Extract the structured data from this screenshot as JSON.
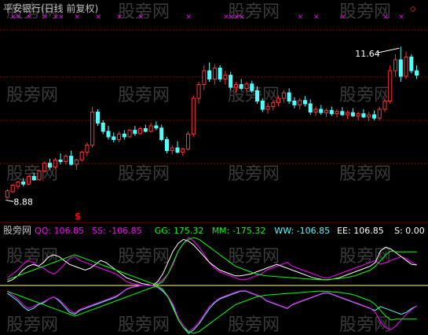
{
  "window": {
    "title": "平安银行(日线 前复权)"
  },
  "watermark": {
    "text": "股旁网"
  },
  "colors": {
    "background": "#000000",
    "up_candle": "#ff3232",
    "down_candle": "#54fcfc",
    "grid": "#8b0000",
    "magenta": "#ff00ff",
    "white": "#ffffff",
    "green": "#00ff00",
    "yellow": "#ffff00",
    "cyan": "#54fcfc",
    "title": "#c0c0c0",
    "signal": "#ff0000"
  },
  "price_panel": {
    "high_label": "11.64",
    "low_label": "8.88",
    "signal_label": "$",
    "ylim": [
      8.6,
      12.2
    ],
    "marker_count": 20
  },
  "indicator_panel": {
    "name": "股旁网",
    "readouts": [
      {
        "label": "QQ: 106.85",
        "color": "#ff00ff"
      },
      {
        "label": "SS: -106.85",
        "color": "#ff00ff"
      },
      {
        "label": "GG: 175.32",
        "color": "#00ff00"
      },
      {
        "label": "MM: -175.32",
        "color": "#00ff00"
      },
      {
        "label": "WW: -106.85",
        "color": "#54fcfc"
      },
      {
        "label": "EE: 106.85",
        "color": "#ffffff"
      },
      {
        "label": "S: 0.00",
        "color": "#ffffff"
      }
    ]
  },
  "chart_data": {
    "type": "candlestick",
    "title": "平安银行(日线 前复权)",
    "annotations": [
      "11.64",
      "8.88"
    ],
    "candles": [
      {
        "o": 8.9,
        "h": 9.05,
        "l": 8.88,
        "c": 9.02
      },
      {
        "o": 9.0,
        "h": 9.15,
        "l": 8.98,
        "c": 9.12
      },
      {
        "o": 9.1,
        "h": 9.2,
        "l": 9.05,
        "c": 9.18
      },
      {
        "o": 9.18,
        "h": 9.25,
        "l": 9.1,
        "c": 9.14
      },
      {
        "o": 9.14,
        "h": 9.3,
        "l": 9.12,
        "c": 9.28
      },
      {
        "o": 9.28,
        "h": 9.35,
        "l": 9.2,
        "c": 9.22
      },
      {
        "o": 9.22,
        "h": 9.4,
        "l": 9.2,
        "c": 9.38
      },
      {
        "o": 9.38,
        "h": 9.55,
        "l": 9.35,
        "c": 9.52
      },
      {
        "o": 9.52,
        "h": 9.6,
        "l": 9.4,
        "c": 9.45
      },
      {
        "o": 9.45,
        "h": 9.62,
        "l": 9.42,
        "c": 9.58
      },
      {
        "o": 9.58,
        "h": 9.7,
        "l": 9.5,
        "c": 9.55
      },
      {
        "o": 9.55,
        "h": 9.68,
        "l": 9.5,
        "c": 9.65
      },
      {
        "o": 9.65,
        "h": 9.75,
        "l": 9.48,
        "c": 9.5
      },
      {
        "o": 9.5,
        "h": 9.6,
        "l": 9.4,
        "c": 9.58
      },
      {
        "o": 9.58,
        "h": 9.75,
        "l": 9.55,
        "c": 9.72
      },
      {
        "o": 9.72,
        "h": 9.9,
        "l": 9.65,
        "c": 9.85
      },
      {
        "o": 9.85,
        "h": 10.55,
        "l": 9.8,
        "c": 10.45
      },
      {
        "o": 10.45,
        "h": 10.5,
        "l": 10.2,
        "c": 10.25
      },
      {
        "o": 10.25,
        "h": 10.3,
        "l": 10.05,
        "c": 10.1
      },
      {
        "o": 10.1,
        "h": 10.2,
        "l": 9.95,
        "c": 10.0
      },
      {
        "o": 10.0,
        "h": 10.08,
        "l": 9.9,
        "c": 9.95
      },
      {
        "o": 9.95,
        "h": 10.1,
        "l": 9.9,
        "c": 10.05
      },
      {
        "o": 10.05,
        "h": 10.12,
        "l": 9.95,
        "c": 10.0
      },
      {
        "o": 10.0,
        "h": 10.15,
        "l": 9.98,
        "c": 10.12
      },
      {
        "o": 10.12,
        "h": 10.2,
        "l": 10.02,
        "c": 10.06
      },
      {
        "o": 10.06,
        "h": 10.18,
        "l": 10.04,
        "c": 10.15
      },
      {
        "o": 10.15,
        "h": 10.22,
        "l": 10.08,
        "c": 10.1
      },
      {
        "o": 10.1,
        "h": 10.25,
        "l": 10.08,
        "c": 10.2
      },
      {
        "o": 10.2,
        "h": 10.28,
        "l": 10.12,
        "c": 10.16
      },
      {
        "o": 10.16,
        "h": 10.22,
        "l": 9.92,
        "c": 9.95
      },
      {
        "o": 9.95,
        "h": 10.0,
        "l": 9.7,
        "c": 9.75
      },
      {
        "o": 9.75,
        "h": 9.85,
        "l": 9.68,
        "c": 9.8
      },
      {
        "o": 9.8,
        "h": 9.92,
        "l": 9.7,
        "c": 9.72
      },
      {
        "o": 9.72,
        "h": 9.8,
        "l": 9.65,
        "c": 9.78
      },
      {
        "o": 9.78,
        "h": 10.1,
        "l": 9.75,
        "c": 10.05
      },
      {
        "o": 10.05,
        "h": 10.75,
        "l": 10.0,
        "c": 10.7
      },
      {
        "o": 10.7,
        "h": 11.0,
        "l": 10.6,
        "c": 10.95
      },
      {
        "o": 10.95,
        "h": 11.3,
        "l": 10.85,
        "c": 11.2
      },
      {
        "o": 11.2,
        "h": 11.35,
        "l": 11.0,
        "c": 11.05
      },
      {
        "o": 11.05,
        "h": 11.32,
        "l": 10.95,
        "c": 11.25
      },
      {
        "o": 11.25,
        "h": 11.3,
        "l": 11.0,
        "c": 11.05
      },
      {
        "o": 11.05,
        "h": 11.2,
        "l": 10.95,
        "c": 11.12
      },
      {
        "o": 11.12,
        "h": 11.18,
        "l": 10.85,
        "c": 10.9
      },
      {
        "o": 10.9,
        "h": 11.0,
        "l": 10.8,
        "c": 10.95
      },
      {
        "o": 10.95,
        "h": 11.05,
        "l": 10.85,
        "c": 10.88
      },
      {
        "o": 10.88,
        "h": 11.0,
        "l": 10.82,
        "c": 10.96
      },
      {
        "o": 10.96,
        "h": 11.02,
        "l": 10.8,
        "c": 10.84
      },
      {
        "o": 10.84,
        "h": 10.92,
        "l": 10.6,
        "c": 10.65
      },
      {
        "o": 10.65,
        "h": 10.7,
        "l": 10.45,
        "c": 10.5
      },
      {
        "o": 10.5,
        "h": 10.62,
        "l": 10.42,
        "c": 10.55
      },
      {
        "o": 10.55,
        "h": 10.68,
        "l": 10.48,
        "c": 10.62
      },
      {
        "o": 10.62,
        "h": 10.75,
        "l": 10.55,
        "c": 10.7
      },
      {
        "o": 10.7,
        "h": 10.85,
        "l": 10.62,
        "c": 10.8
      },
      {
        "o": 10.8,
        "h": 10.88,
        "l": 10.6,
        "c": 10.65
      },
      {
        "o": 10.65,
        "h": 10.72,
        "l": 10.52,
        "c": 10.58
      },
      {
        "o": 10.58,
        "h": 10.7,
        "l": 10.5,
        "c": 10.66
      },
      {
        "o": 10.66,
        "h": 10.74,
        "l": 10.55,
        "c": 10.6
      },
      {
        "o": 10.6,
        "h": 10.68,
        "l": 10.4,
        "c": 10.45
      },
      {
        "o": 10.45,
        "h": 10.55,
        "l": 10.38,
        "c": 10.5
      },
      {
        "o": 10.5,
        "h": 10.58,
        "l": 10.4,
        "c": 10.44
      },
      {
        "o": 10.44,
        "h": 10.52,
        "l": 10.36,
        "c": 10.48
      },
      {
        "o": 10.48,
        "h": 10.55,
        "l": 10.38,
        "c": 10.42
      },
      {
        "o": 10.42,
        "h": 10.5,
        "l": 10.35,
        "c": 10.46
      },
      {
        "o": 10.46,
        "h": 10.54,
        "l": 10.38,
        "c": 10.4
      },
      {
        "o": 10.4,
        "h": 10.48,
        "l": 10.32,
        "c": 10.44
      },
      {
        "o": 10.44,
        "h": 10.52,
        "l": 10.36,
        "c": 10.38
      },
      {
        "o": 10.38,
        "h": 10.46,
        "l": 10.3,
        "c": 10.42
      },
      {
        "o": 10.42,
        "h": 10.5,
        "l": 10.34,
        "c": 10.36
      },
      {
        "o": 10.36,
        "h": 10.45,
        "l": 10.28,
        "c": 10.4
      },
      {
        "o": 10.4,
        "h": 10.48,
        "l": 10.3,
        "c": 10.34
      },
      {
        "o": 10.34,
        "h": 10.55,
        "l": 10.3,
        "c": 10.5
      },
      {
        "o": 10.5,
        "h": 10.7,
        "l": 10.45,
        "c": 10.65
      },
      {
        "o": 10.65,
        "h": 11.3,
        "l": 10.6,
        "c": 11.2
      },
      {
        "o": 11.2,
        "h": 11.5,
        "l": 11.1,
        "c": 11.4
      },
      {
        "o": 11.4,
        "h": 11.64,
        "l": 11.0,
        "c": 11.1
      },
      {
        "o": 11.1,
        "h": 11.55,
        "l": 11.05,
        "c": 11.45
      },
      {
        "o": 11.45,
        "h": 11.5,
        "l": 11.15,
        "c": 11.2
      },
      {
        "o": 11.2,
        "h": 11.3,
        "l": 11.05,
        "c": 11.12
      }
    ],
    "markers": [
      1,
      2,
      4,
      7,
      9,
      10,
      13,
      17,
      21,
      25,
      34,
      41,
      42,
      43,
      44,
      55,
      58,
      63,
      71,
      74
    ],
    "indicator": {
      "range": [
        -250,
        250
      ],
      "series": [
        {
          "name": "QQ",
          "color": "#ff00ff",
          "values": [
            40,
            60,
            80,
            110,
            130,
            120,
            100,
            90,
            70,
            60,
            80,
            110,
            140,
            150,
            130,
            120,
            110,
            100,
            90,
            80,
            70,
            60,
            40,
            20,
            10,
            5,
            0,
            0,
            0,
            10,
            30,
            60,
            110,
            180,
            220,
            250,
            230,
            200,
            160,
            120,
            90,
            70,
            60,
            50,
            40,
            30,
            30,
            40,
            50,
            60,
            80,
            90,
            100,
            110,
            120,
            100,
            90,
            80,
            70,
            60,
            50,
            40,
            40,
            50,
            60,
            70,
            80,
            90,
            100,
            110,
            120,
            130,
            110,
            120,
            130,
            140,
            150,
            140,
            120,
            106.85
          ]
        },
        {
          "name": "EE",
          "color": "#ffffff",
          "values": [
            20,
            30,
            50,
            80,
            100,
            110,
            100,
            120,
            150,
            160,
            150,
            130,
            110,
            100,
            90,
            80,
            90,
            110,
            130,
            120,
            100,
            80,
            60,
            40,
            30,
            20,
            10,
            5,
            0,
            20,
            60,
            120,
            180,
            220,
            240,
            230,
            210,
            180,
            150,
            120,
            100,
            80,
            70,
            60,
            50,
            50,
            55,
            60,
            70,
            80,
            90,
            100,
            110,
            100,
            90,
            80,
            70,
            60,
            50,
            40,
            35,
            30,
            30,
            35,
            40,
            50,
            60,
            70,
            80,
            90,
            100,
            120,
            180,
            200,
            190,
            170,
            150,
            130,
            110,
            106.85
          ]
        },
        {
          "name": "GG",
          "color": "#00ff00",
          "values": [
            30,
            40,
            50,
            60,
            70,
            80,
            90,
            100,
            110,
            120,
            130,
            140,
            150,
            160,
            150,
            140,
            130,
            120,
            110,
            100,
            90,
            80,
            70,
            60,
            50,
            40,
            30,
            20,
            10,
            5,
            20,
            60,
            120,
            180,
            220,
            240,
            250,
            240,
            220,
            200,
            180,
            160,
            140,
            120,
            100,
            90,
            80,
            70,
            60,
            55,
            50,
            48,
            46,
            44,
            42,
            40,
            38,
            36,
            34,
            32,
            30,
            30,
            32,
            34,
            36,
            40,
            44,
            50,
            60,
            70,
            80,
            100,
            130,
            160,
            180,
            175.32,
            175.32,
            175.32,
            175.32,
            175.32
          ]
        },
        {
          "name": "WW",
          "color": "#54fcfc",
          "values": [
            -40,
            -60,
            -80,
            -110,
            -130,
            -120,
            -100,
            -90,
            -70,
            -60,
            -80,
            -110,
            -140,
            -150,
            -130,
            -120,
            -110,
            -100,
            -90,
            -80,
            -70,
            -60,
            -40,
            -20,
            -10,
            -5,
            0,
            0,
            0,
            -10,
            -30,
            -60,
            -110,
            -180,
            -220,
            -250,
            -230,
            -200,
            -160,
            -120,
            -90,
            -70,
            -60,
            -50,
            -40,
            -30,
            -30,
            -40,
            -50,
            -60,
            -80,
            -90,
            -100,
            -110,
            -120,
            -100,
            -90,
            -80,
            -70,
            -60,
            -50,
            -40,
            -40,
            -50,
            -60,
            -70,
            -80,
            -90,
            -100,
            -110,
            -120,
            -130,
            -110,
            -120,
            -130,
            -140,
            -150,
            -140,
            -120,
            -106.85
          ]
        },
        {
          "name": "SS",
          "color": "#ff00ff",
          "values": [
            -30,
            -50,
            -70,
            -100,
            -120,
            -110,
            -95,
            -85,
            -70,
            -60,
            -75,
            -100,
            -130,
            -145,
            -125,
            -115,
            -105,
            -95,
            -85,
            -75,
            -65,
            -55,
            -38,
            -18,
            -8,
            -4,
            0,
            0,
            0,
            -8,
            -25,
            -55,
            -100,
            -170,
            -210,
            -240,
            -220,
            -190,
            -150,
            -110,
            -85,
            -65,
            -55,
            -45,
            -35,
            -28,
            -28,
            -38,
            -48,
            -58,
            -78,
            -88,
            -98,
            -108,
            -118,
            -98,
            -88,
            -78,
            -68,
            -58,
            -48,
            -38,
            -38,
            -48,
            -58,
            -68,
            -78,
            -88,
            -98,
            -108,
            -118,
            -140,
            -190,
            -220,
            -230,
            -210,
            -180,
            -150,
            -125,
            -106.85
          ]
        },
        {
          "name": "MM",
          "color": "#00ff00",
          "values": [
            -30,
            -40,
            -50,
            -60,
            -70,
            -80,
            -90,
            -100,
            -110,
            -120,
            -130,
            -140,
            -150,
            -160,
            -150,
            -140,
            -130,
            -120,
            -110,
            -100,
            -90,
            -80,
            -70,
            -60,
            -50,
            -40,
            -30,
            -20,
            -10,
            -5,
            -20,
            -60,
            -120,
            -180,
            -220,
            -240,
            -250,
            -240,
            -220,
            -200,
            -180,
            -160,
            -140,
            -120,
            -100,
            -90,
            -80,
            -70,
            -60,
            -55,
            -50,
            -48,
            -46,
            -44,
            -42,
            -40,
            -38,
            -36,
            -34,
            -32,
            -30,
            -30,
            -32,
            -34,
            -36,
            -40,
            -44,
            -50,
            -60,
            -70,
            -80,
            -100,
            -130,
            -160,
            -180,
            -175.32,
            -175.32,
            -175.32,
            -175.32,
            -175.32
          ]
        }
      ]
    }
  }
}
